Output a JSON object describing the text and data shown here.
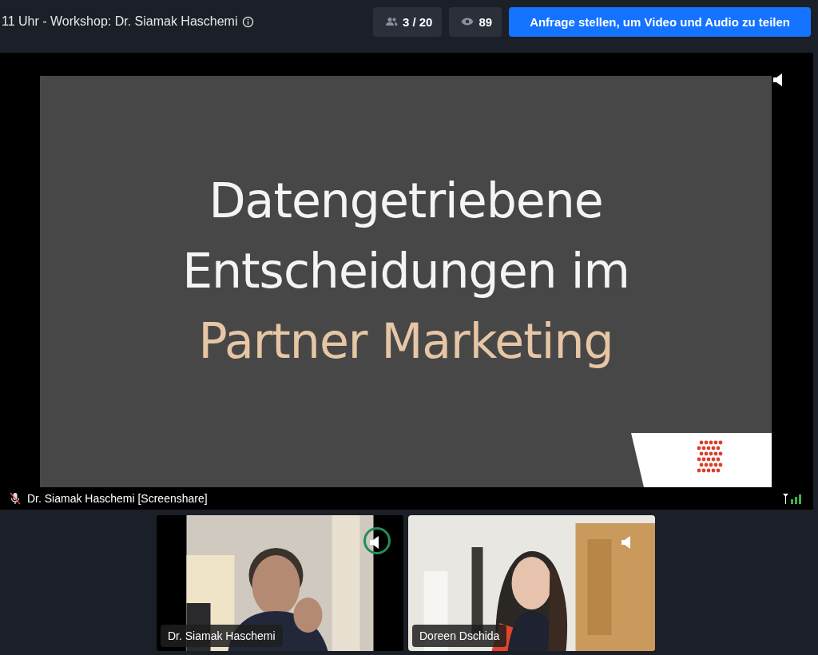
{
  "header": {
    "title": "11 Uhr - Workshop: Dr. Siamak Haschemi",
    "participants": "3 / 20",
    "viewers": "89",
    "request_button": "Anfrage stellen, um Video und Audio zu teilen"
  },
  "stage": {
    "slide_lines": [
      {
        "text": "Datengetriebene",
        "kind": "plain"
      },
      {
        "text": "Entscheidungen im",
        "kind": "plain"
      },
      {
        "text": "Partner Marketing",
        "kind": "accent"
      }
    ],
    "label": "Dr. Siamak Haschemi [Screenshare]",
    "muted": true
  },
  "tiles": [
    {
      "name": "Dr. Siamak Haschemi",
      "speaking": true,
      "kind": "picture"
    },
    {
      "name": "Doreen Dschida",
      "speaking": false,
      "kind": "picture"
    }
  ]
}
